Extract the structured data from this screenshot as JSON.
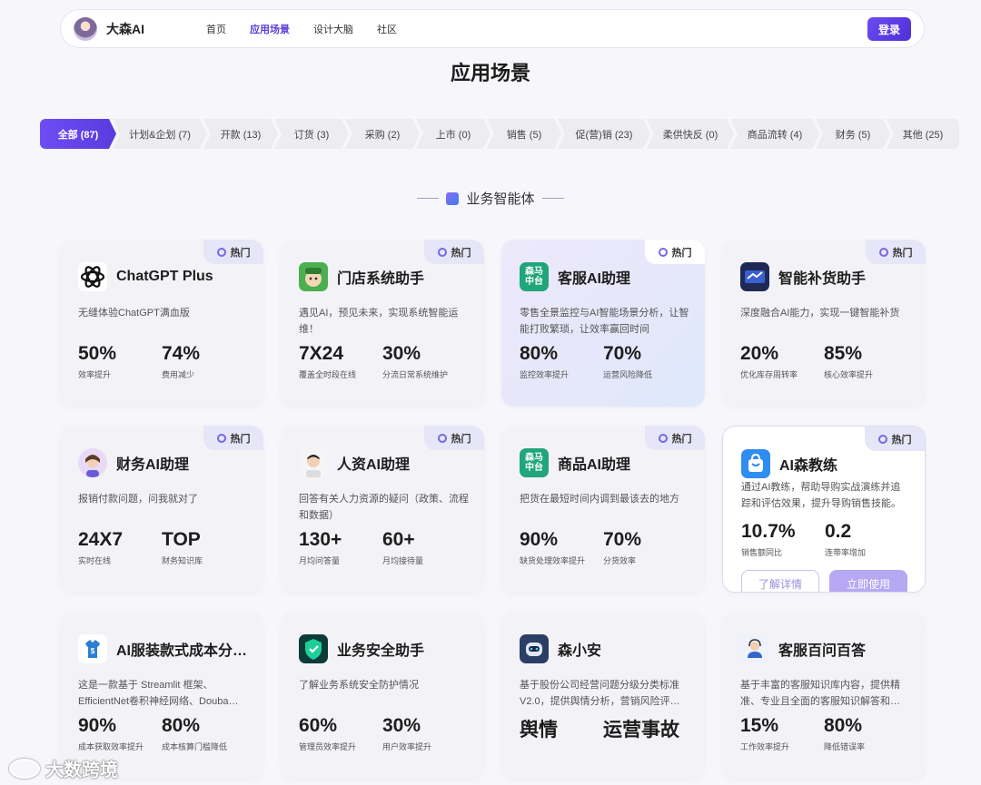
{
  "header": {
    "brand": "大森AI",
    "nav": [
      {
        "label": "首页",
        "active": false
      },
      {
        "label": "应用场景",
        "active": true
      },
      {
        "label": "设计大脑",
        "active": false
      },
      {
        "label": "社区",
        "active": false
      }
    ],
    "login_label": "登录"
  },
  "page_title": "应用场景",
  "filters": [
    {
      "label": "全部 (87)",
      "active": true
    },
    {
      "label": "计划&企划 (7)"
    },
    {
      "label": "开款 (13)"
    },
    {
      "label": "订货 (3)"
    },
    {
      "label": "采购 (2)"
    },
    {
      "label": "上市 (0)"
    },
    {
      "label": "销售 (5)"
    },
    {
      "label": "促(营)销 (23)"
    },
    {
      "label": "柔供快反 (0)"
    },
    {
      "label": "商品流转 (4)"
    },
    {
      "label": "财务 (5)"
    },
    {
      "label": "其他 (25)"
    }
  ],
  "section_title": "业务智能体",
  "hot_label": "热门",
  "cards": [
    {
      "title": "ChatGPT Plus",
      "desc": "无缝体验ChatGPT满血版",
      "stats": [
        {
          "v": "50%",
          "l": "效率提升"
        },
        {
          "v": "74%",
          "l": "费用减少"
        }
      ],
      "icon": "openai-icon",
      "hot": true
    },
    {
      "title": "门店系统助手",
      "desc": "遇见AI，预见未来，实现系统智能运维！",
      "stats": [
        {
          "v": "7X24",
          "l": "覆盖全时段在线"
        },
        {
          "v": "30%",
          "l": "分流日常系统维护"
        }
      ],
      "icon": "store-assistant-icon",
      "hot": true
    },
    {
      "title": "客服AI助理",
      "desc": "零售全景监控与AI智能场景分析，让智能打败繁琐，让效率赢回时间",
      "stats": [
        {
          "v": "80%",
          "l": "监控效率提升"
        },
        {
          "v": "70%",
          "l": "运营风险降低"
        }
      ],
      "icon": "senma-platform-icon",
      "icon_text": "森马\n中台",
      "hot": true
    },
    {
      "title": "智能补货助手",
      "desc": "深度融合AI能力，实现一键智能补货",
      "stats": [
        {
          "v": "20%",
          "l": "优化库存周转率"
        },
        {
          "v": "85%",
          "l": "核心效率提升"
        }
      ],
      "icon": "replenish-icon",
      "hot": true
    },
    {
      "title": "财务AI助理",
      "desc": "报销付款问题，问我就对了",
      "stats": [
        {
          "v": "24X7",
          "l": "实时在线"
        },
        {
          "v": "TOP",
          "l": "财务知识库"
        }
      ],
      "icon": "finance-avatar-icon",
      "hot": true
    },
    {
      "title": "人资AI助理",
      "desc": "回答有关人力资源的疑问（政策、流程和数据）",
      "stats": [
        {
          "v": "130+",
          "l": "月均问答量"
        },
        {
          "v": "60+",
          "l": "月均接待量"
        }
      ],
      "icon": "hr-avatar-icon",
      "hot": true
    },
    {
      "title": "商品AI助理",
      "desc": "把货在最短时间内调到最该去的地方",
      "stats": [
        {
          "v": "90%",
          "l": "缺货处理效率提升"
        },
        {
          "v": "70%",
          "l": "分货效率"
        }
      ],
      "icon": "senma-platform-icon",
      "icon_text": "森马\n中台",
      "hot": true
    },
    {
      "title": "AI森教练",
      "desc": "通过AI教练，帮助导购实战演练并追踪和评估效果，提升导购销售技能。",
      "stats": [
        {
          "v": "10.7%",
          "l": "销售额同比"
        },
        {
          "v": "0.2",
          "l": "连带率增加"
        }
      ],
      "icon": "shopping-bag-icon",
      "hot": true,
      "buttons": [
        "了解详情",
        "立即使用"
      ]
    },
    {
      "title": "AI服装款式成本分…",
      "desc": "这是一款基于 Streamlit 框架、EfficientNet卷积神经网络、Douba…",
      "stats": [
        {
          "v": "90%",
          "l": "成本获取效率提升"
        },
        {
          "v": "80%",
          "l": "成本核算门槛降低"
        }
      ],
      "icon": "garment-cost-icon",
      "hot": false
    },
    {
      "title": "业务安全助手",
      "desc": "了解业务系统安全防护情况",
      "stats": [
        {
          "v": "60%",
          "l": "管理员效率提升"
        },
        {
          "v": "30%",
          "l": "用户效率提升"
        }
      ],
      "icon": "security-shield-icon",
      "hot": false
    },
    {
      "title": "森小安",
      "desc": "基于股份公司经营问题分级分类标准V2.0，提供舆情分析，营销风险评…",
      "stats": [
        {
          "v": "舆情",
          "l": ""
        },
        {
          "v": "运营事故",
          "l": ""
        }
      ],
      "icon": "robot-icon",
      "hot": false
    },
    {
      "title": "客服百问百答",
      "desc": "基于丰富的客服知识库内容，提供精准、专业且全面的客服知识解答和…",
      "stats": [
        {
          "v": "15%",
          "l": "工作效率提升"
        },
        {
          "v": "80%",
          "l": "降低错误率"
        }
      ],
      "icon": "customer-service-icon",
      "hot": false
    }
  ],
  "watermark": "大数跨境"
}
